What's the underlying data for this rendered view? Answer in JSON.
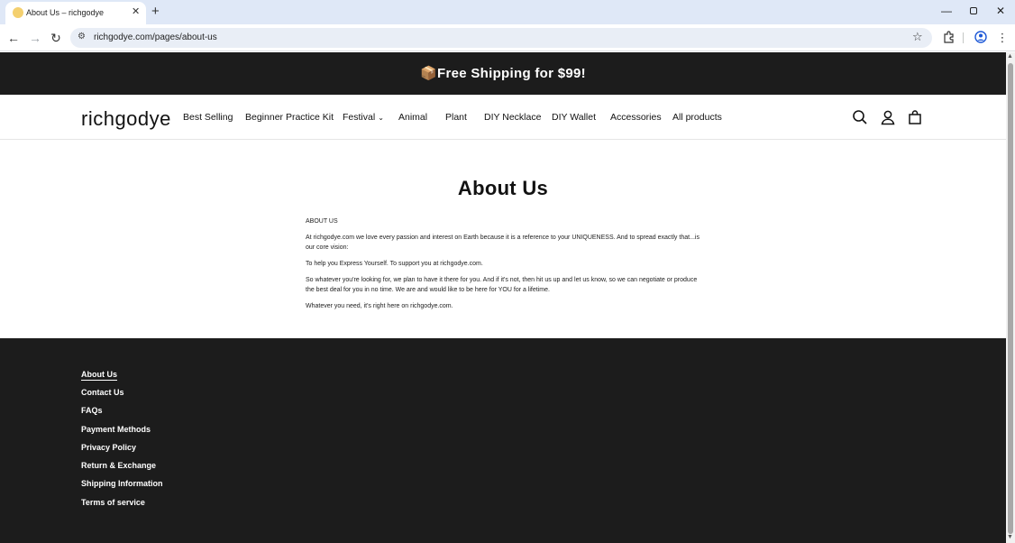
{
  "browser": {
    "tab_title": "About Us – richgodye",
    "url": "richgodye.com/pages/about-us"
  },
  "announcement": {
    "icon": "package-icon",
    "text": "📦Free Shipping for $99!"
  },
  "header": {
    "logo": "richgodye",
    "nav": [
      {
        "label": "Best Selling"
      },
      {
        "label": "Beginner Practice Kit"
      },
      {
        "label": "Festival",
        "has_dropdown": true
      },
      {
        "label": "Animal"
      },
      {
        "label": "Plant"
      },
      {
        "label": "DIY Necklace"
      },
      {
        "label": "DIY Wallet"
      },
      {
        "label": "Accessories"
      },
      {
        "label": "All products"
      }
    ],
    "icons": [
      "search-icon",
      "account-icon",
      "cart-icon"
    ]
  },
  "main": {
    "title": "About Us",
    "paragraphs": [
      "ABOUT US",
      "At richgodye.com  we love every passion and interest on Earth because it is a reference to your UNIQUENESS. And to spread exactly that...is our core vision:",
      "To help you Express Yourself. To support you at richgodye.com.",
      "So whatever you're looking for, we plan to have it there for you. And if it's not, then hit us up and let us know, so we can negotiate or produce the best deal for you in no time. We are and would like to be here for YOU for a lifetime.",
      "Whatever you need, it's right here on richgodye.com."
    ]
  },
  "footer": {
    "links": [
      {
        "label": "About Us",
        "active": true
      },
      {
        "label": "Contact Us"
      },
      {
        "label": "FAQs"
      },
      {
        "label": "Payment Methods"
      },
      {
        "label": "Privacy Policy"
      },
      {
        "label": "Return & Exchange"
      },
      {
        "label": "Shipping Information"
      },
      {
        "label": "Terms of service"
      }
    ]
  },
  "colors": {
    "announcement_bg": "#1c1c1c",
    "footer_bg": "#1c1c1c",
    "text": "#121212",
    "tabbar_bg": "#dfe8f7"
  }
}
